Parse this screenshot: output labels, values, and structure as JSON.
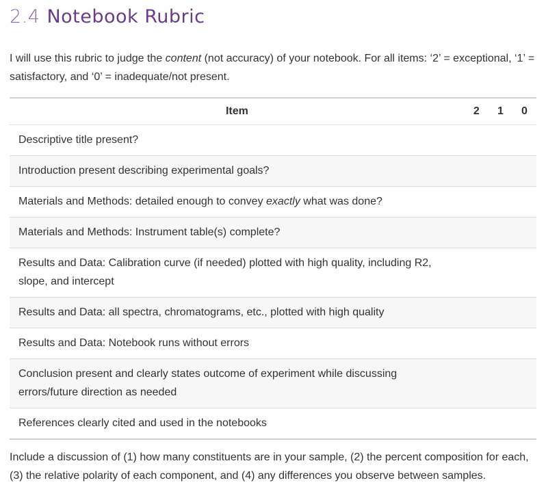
{
  "section": {
    "number": "2.4",
    "title": "Notebook Rubric"
  },
  "intro": {
    "before_em": "I will use this rubric to judge the ",
    "em": "content",
    "after_em": " (not accuracy) of your notebook. For all items: ‘2’ = exceptional, ‘1’ = satisfactory, and ‘0’ = inadequate/not present."
  },
  "table": {
    "headers": {
      "item": "Item",
      "score_2": "2",
      "score_1": "1",
      "score_0": "0"
    },
    "rows": [
      {
        "before": "Descriptive title present?",
        "em": "",
        "after": ""
      },
      {
        "before": "Introduction present describing experimental goals?",
        "em": "",
        "after": ""
      },
      {
        "before": "Materials and Methods: detailed enough to convey ",
        "em": "exactly",
        "after": " what was done?"
      },
      {
        "before": "Materials and Methods: Instrument table(s) complete?",
        "em": "",
        "after": ""
      },
      {
        "before": "Results and Data: Calibration curve (if needed) plotted with high quality, including R2, slope, and intercept",
        "em": "",
        "after": ""
      },
      {
        "before": "Results and Data: all spectra, chromatograms, etc., plotted with high quality",
        "em": "",
        "after": ""
      },
      {
        "before": "Results and Data: Notebook runs without errors",
        "em": "",
        "after": ""
      },
      {
        "before": "Conclusion present and clearly states outcome of experiment while discussing errors/future direction as needed",
        "em": "",
        "after": ""
      },
      {
        "before": "References clearly cited and used in the notebooks",
        "em": "",
        "after": ""
      }
    ]
  },
  "closing": "Include a discussion of (1) how many constituents are in your sample, (2) the percent composition for each, (3) the relative polarity of each component, and (4) any differences you observe between samples.",
  "colors": {
    "heading": "#6b3b87",
    "text": "#333333",
    "stripe": "#f7f7f7",
    "rule": "#d0d0d0"
  }
}
